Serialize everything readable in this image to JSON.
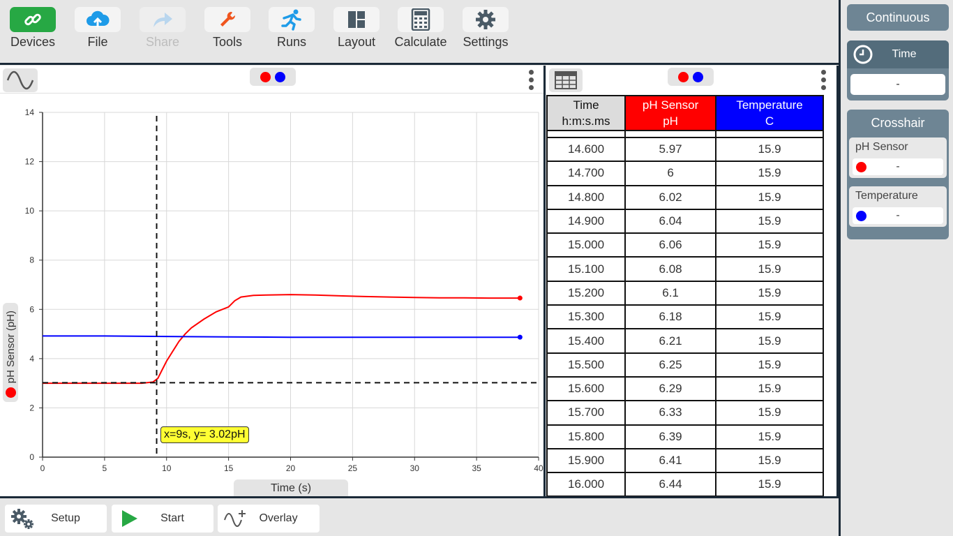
{
  "toolbar": {
    "buttons": [
      {
        "label": "Devices",
        "icon": "link-icon",
        "state": "active"
      },
      {
        "label": "File",
        "icon": "cloud-upload-icon",
        "state": "normal"
      },
      {
        "label": "Share",
        "icon": "share-arrow-icon",
        "state": "disabled"
      },
      {
        "label": "Tools",
        "icon": "wrench-icon",
        "state": "normal"
      },
      {
        "label": "Runs",
        "icon": "runner-icon",
        "state": "normal"
      },
      {
        "label": "Layout",
        "icon": "layout-icon",
        "state": "normal"
      },
      {
        "label": "Calculate",
        "icon": "calculator-icon",
        "state": "normal"
      },
      {
        "label": "Settings",
        "icon": "gear-icon",
        "state": "normal"
      }
    ]
  },
  "graph": {
    "y_axis_label": "pH Sensor (pH)",
    "x_axis_label": "Time (s)",
    "crosshair_tooltip": "x=9s, y= 3.02pH",
    "colors": {
      "ph": "#ff0000",
      "temperature": "#0000ff"
    },
    "chart_data": {
      "type": "line",
      "xlim": [
        0,
        40
      ],
      "ylim": [
        0,
        14
      ],
      "x_ticks": [
        0,
        5,
        10,
        15,
        20,
        25,
        30,
        35,
        40
      ],
      "y_ticks": [
        0,
        2,
        4,
        6,
        8,
        10,
        12,
        14
      ],
      "crosshair": {
        "x": 9.2,
        "y": 3.02
      },
      "series": [
        {
          "color": "#ff0000",
          "x": [
            0,
            2,
            4,
            6,
            8,
            8.9,
            9.3,
            9.6,
            10,
            10.5,
            11,
            11.5,
            12,
            13,
            14,
            15,
            15.5,
            16,
            17,
            18,
            20,
            22,
            24,
            26,
            28,
            30,
            32,
            34,
            36,
            38.5
          ],
          "y": [
            3.0,
            3.0,
            3.0,
            3.0,
            3.0,
            3.05,
            3.2,
            3.5,
            3.9,
            4.3,
            4.7,
            5.0,
            5.25,
            5.6,
            5.9,
            6.1,
            6.35,
            6.5,
            6.57,
            6.58,
            6.6,
            6.58,
            6.55,
            6.52,
            6.5,
            6.48,
            6.47,
            6.47,
            6.46,
            6.46
          ]
        },
        {
          "color": "#0000ff",
          "x": [
            0,
            5,
            10,
            15,
            20,
            25,
            30,
            35,
            38.5
          ],
          "y": [
            4.92,
            4.92,
            4.9,
            4.88,
            4.87,
            4.87,
            4.87,
            4.87,
            4.87
          ]
        }
      ]
    }
  },
  "table": {
    "headers": [
      {
        "line1": "Time",
        "line2": "h:m:s.ms"
      },
      {
        "line1": "pH Sensor",
        "line2": "pH"
      },
      {
        "line1": "Temperature",
        "line2": "C"
      }
    ],
    "rows": [
      [
        "14.600",
        "5.97",
        "15.9"
      ],
      [
        "14.700",
        "6",
        "15.9"
      ],
      [
        "14.800",
        "6.02",
        "15.9"
      ],
      [
        "14.900",
        "6.04",
        "15.9"
      ],
      [
        "15.000",
        "6.06",
        "15.9"
      ],
      [
        "15.100",
        "6.08",
        "15.9"
      ],
      [
        "15.200",
        "6.1",
        "15.9"
      ],
      [
        "15.300",
        "6.18",
        "15.9"
      ],
      [
        "15.400",
        "6.21",
        "15.9"
      ],
      [
        "15.500",
        "6.25",
        "15.9"
      ],
      [
        "15.600",
        "6.29",
        "15.9"
      ],
      [
        "15.700",
        "6.33",
        "15.9"
      ],
      [
        "15.800",
        "6.39",
        "15.9"
      ],
      [
        "15.900",
        "6.41",
        "15.9"
      ],
      [
        "16.000",
        "6.44",
        "15.9"
      ]
    ]
  },
  "bottombar": {
    "setup_label": "Setup",
    "start_label": "Start",
    "overlay_label": "Overlay"
  },
  "sidebar": {
    "mode_label": "Continuous",
    "time_label": "Time",
    "time_value": "-",
    "crosshair_label": "Crosshair",
    "sensors": [
      {
        "name": "pH Sensor",
        "value": "-",
        "color": "#ff0000"
      },
      {
        "name": "Temperature",
        "value": "-",
        "color": "#0000ff"
      }
    ]
  }
}
